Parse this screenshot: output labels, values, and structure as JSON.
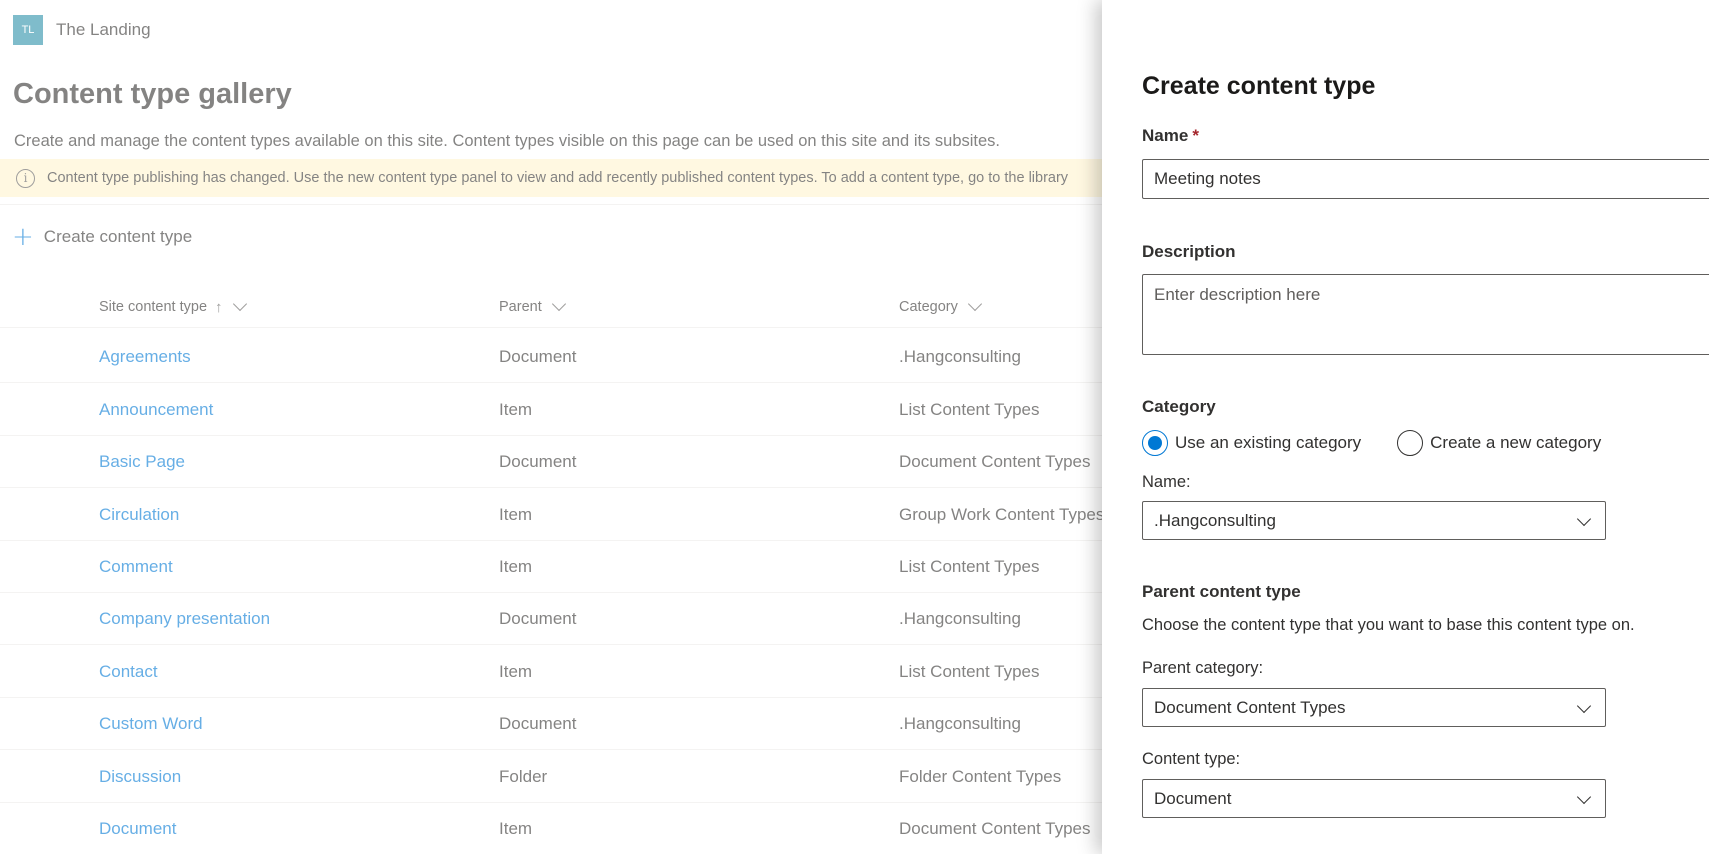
{
  "site": {
    "logo_initials": "TL",
    "name": "The Landing"
  },
  "page": {
    "title": "Content type gallery",
    "description": "Create and manage the content types available on this site. Content types visible on this page can be used on this site and its subsites.",
    "info_message": "Content type publishing has changed. Use the new content type panel to view and add recently published content types. To add a content type, go to the library"
  },
  "command_bar": {
    "create_label": "Create content type"
  },
  "list": {
    "columns": {
      "name": "Site content type",
      "parent": "Parent",
      "category": "Category"
    },
    "sort_arrow": "↑",
    "rows": [
      {
        "name": "Agreements",
        "parent": "Document",
        "category": ".Hangconsulting"
      },
      {
        "name": "Announcement",
        "parent": "Item",
        "category": "List Content Types"
      },
      {
        "name": "Basic Page",
        "parent": "Document",
        "category": "Document Content Types"
      },
      {
        "name": "Circulation",
        "parent": "Item",
        "category": "Group Work Content Types"
      },
      {
        "name": "Comment",
        "parent": "Item",
        "category": "List Content Types"
      },
      {
        "name": "Company presentation",
        "parent": "Document",
        "category": ".Hangconsulting"
      },
      {
        "name": "Contact",
        "parent": "Item",
        "category": "List Content Types"
      },
      {
        "name": "Custom Word",
        "parent": "Document",
        "category": ".Hangconsulting"
      },
      {
        "name": "Discussion",
        "parent": "Folder",
        "category": "Folder Content Types"
      },
      {
        "name": "Document",
        "parent": "Item",
        "category": "Document Content Types"
      }
    ]
  },
  "panel": {
    "title": "Create content type",
    "name_label": "Name",
    "required_mark": "*",
    "name_value": "Meeting notes",
    "description_label": "Description",
    "description_placeholder": "Enter description here",
    "category_label": "Category",
    "radio_existing": "Use an existing category",
    "radio_new": "Create a new category",
    "selected_radio": "existing",
    "category_name_label": "Name:",
    "category_name_value": ".Hangconsulting",
    "parent_section_label": "Parent content type",
    "parent_section_desc": "Choose the content type that you want to base this content type on.",
    "parent_category_label": "Parent category:",
    "parent_category_value": "Document Content Types",
    "content_type_label": "Content type:",
    "content_type_value": "Document"
  },
  "colors": {
    "accent": "#0078d4",
    "logo_bg": "#2b8fa8",
    "info_bg": "#fff4ce",
    "required": "#a4262c"
  }
}
